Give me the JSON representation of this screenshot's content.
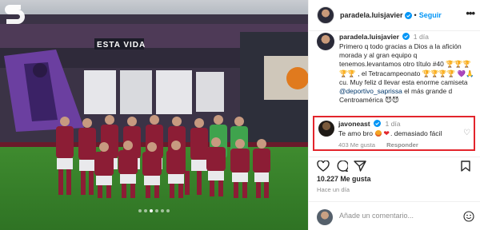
{
  "photo": {
    "banner_text": "ESTA VIDA",
    "carousel_dots": 6,
    "active_dot": 3
  },
  "header": {
    "username": "paradela.luisjavier",
    "separator": "•",
    "follow_label": "Seguir",
    "more_label": "•••"
  },
  "caption": {
    "username": "paradela.luisjavier",
    "time": "1 día",
    "text_before_tag": "Primero q todo gracias a Dios a la afición morada y al gran equipo q tenemos.levantamos otro título #40 🏆🏆🏆🏆🏆 , el Tetracampeonato 🏆🏆🏆🏆 💜🙏 cu. Muy feliz d llevar esta enorme camiseta ",
    "mention": "@deportivo_saprissa",
    "text_after_tag": " el más grande d Centroamérica 😈😈"
  },
  "comment": {
    "username": "javoneast",
    "time": "1 día",
    "text_start": "Te amo bro",
    "text_end": ". demasiado fácil",
    "heart_emoji": "❤",
    "likes": "403 Me gusta",
    "reply_label": "Responder",
    "like_icon": "♡",
    "highlight_color": "#e3252c"
  },
  "stats": {
    "likes": "10.227 Me gusta",
    "time_ago": "Hace un día"
  },
  "add_comment": {
    "placeholder": "Añade un comentario..."
  },
  "colors": {
    "link_blue": "#0095f6",
    "mention_blue": "#00376b",
    "secondary_text": "#8e8e8e",
    "jersey_maroon": "#8c1d35"
  }
}
